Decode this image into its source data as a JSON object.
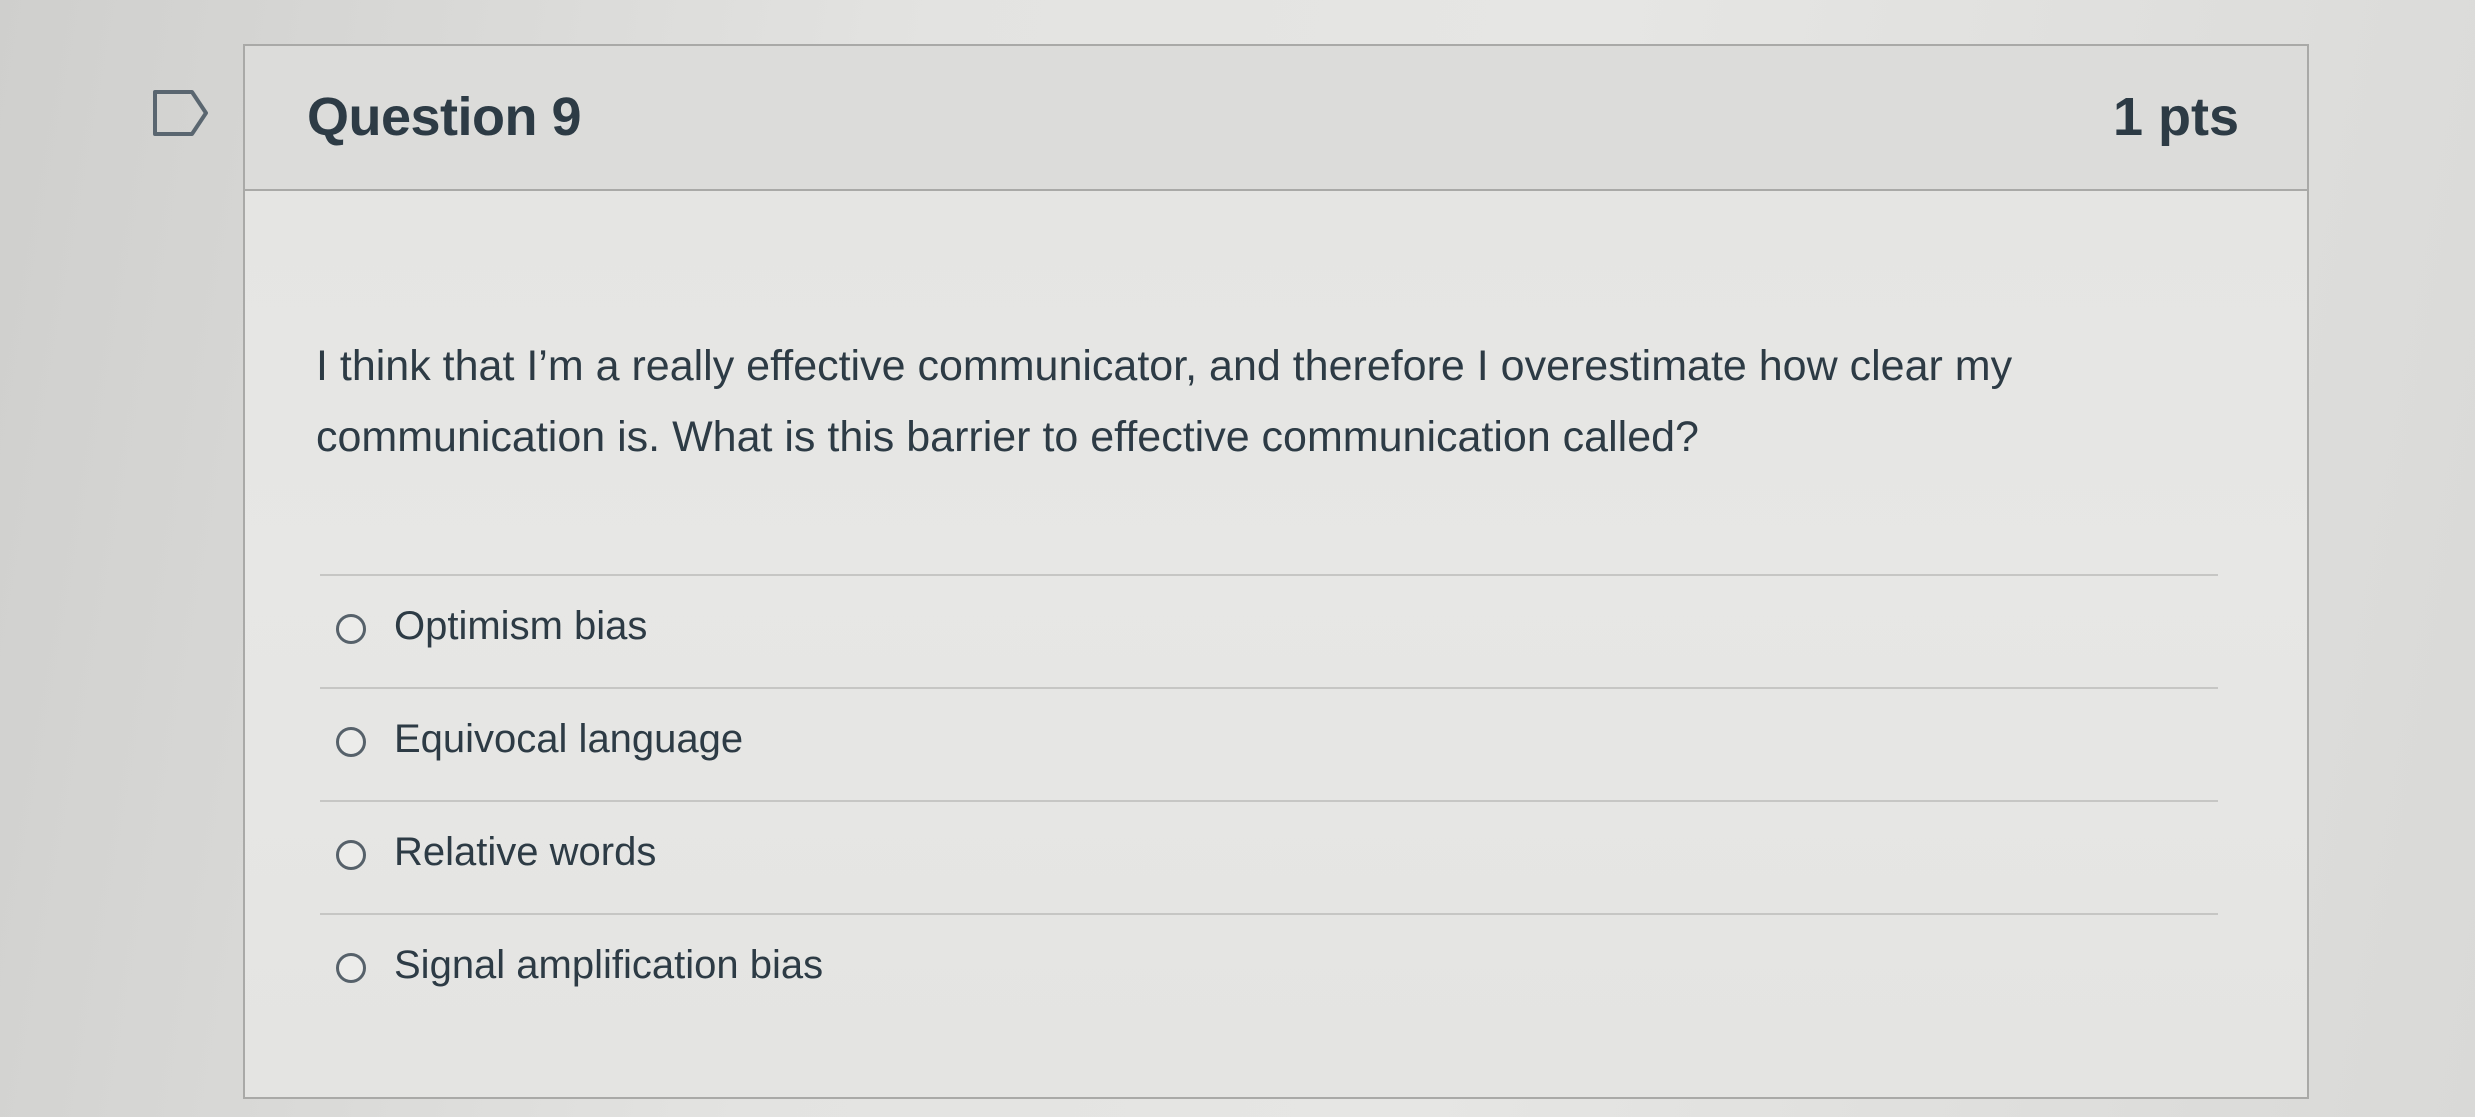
{
  "question": {
    "title": "Question 9",
    "points": "1 pts",
    "text": "I think that I’m a really effective communicator, and therefore I overestimate how clear my communication is. What is this barrier to effective communication called?"
  },
  "answers": [
    {
      "label": "Optimism bias",
      "selected": false
    },
    {
      "label": "Equivocal language",
      "selected": false
    },
    {
      "label": "Relative words",
      "selected": false
    },
    {
      "label": "Signal amplification bias",
      "selected": false
    }
  ],
  "icons": {
    "flag": "flag-question-icon",
    "radio": "radio-unselected-icon"
  },
  "colors": {
    "text": "#2d3b45",
    "border": "#a9a9a7",
    "header_bg": "#dcdcda"
  }
}
